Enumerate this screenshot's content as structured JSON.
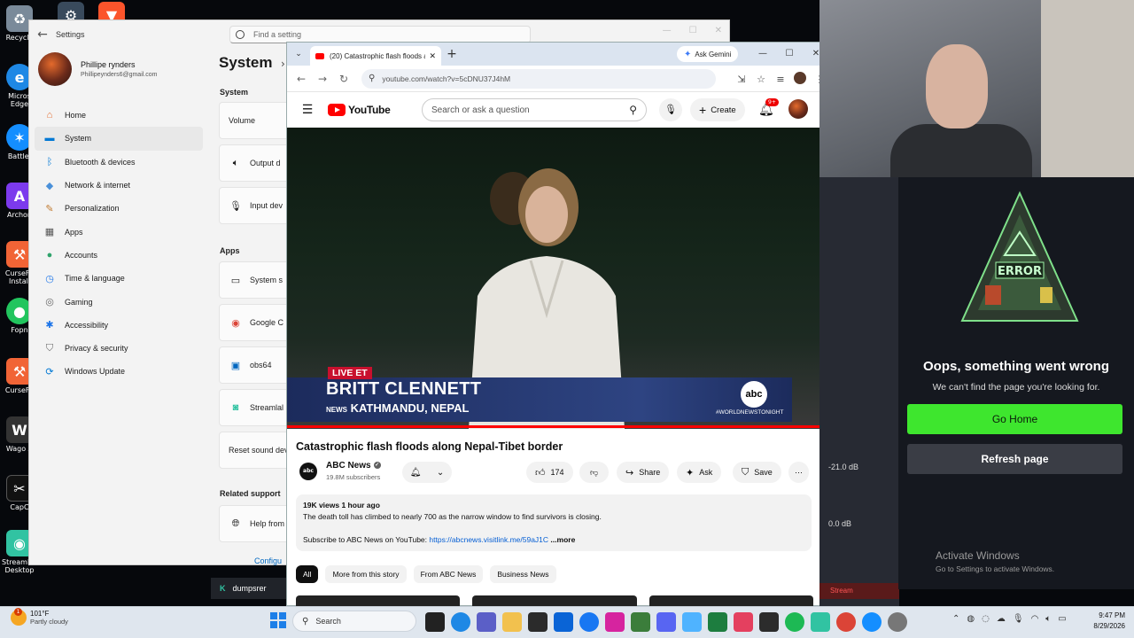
{
  "desktop": {
    "icons": [
      {
        "label": "Recycle",
        "icon": "recycle-bin-icon",
        "color": "#7a8a9a"
      },
      {
        "label": "",
        "icon": "steam-icon",
        "color": "#394a5c"
      },
      {
        "label": "",
        "icon": "brave-icon",
        "color": "#fb542b"
      },
      {
        "label": "Micros Edge",
        "icon": "edge-icon",
        "color": "#1e88e5"
      },
      {
        "label": "Battle.",
        "icon": "battlenet-icon",
        "color": "#148eff"
      },
      {
        "label": "Archon",
        "icon": "archon-icon",
        "color": "#7c3aed"
      },
      {
        "label": "CurseFo Install",
        "icon": "curseforge-icon",
        "color": "#f16436"
      },
      {
        "label": "Fopn",
        "icon": "fopn-icon",
        "color": "#22c55e"
      },
      {
        "label": "CurseFo",
        "icon": "curseforge-icon",
        "color": "#f16436"
      },
      {
        "label": "Wago A",
        "icon": "wago-icon",
        "color": "#333"
      },
      {
        "label": "CapC",
        "icon": "capcut-icon",
        "color": "#111"
      },
      {
        "label": "Streamlabs Desktop",
        "icon": "streamlabs-icon",
        "color": "#31c3a2"
      }
    ]
  },
  "settings": {
    "window_title": "Settings",
    "search_placeholder": "Find a setting",
    "profile": {
      "name": "Phillipe rynders",
      "email": "Phillipeynders6@gmail.com"
    },
    "nav": [
      {
        "label": "Home",
        "icon": "home-icon",
        "color": "#e46a2c"
      },
      {
        "label": "System",
        "icon": "system-icon",
        "color": "#0078d4",
        "active": true
      },
      {
        "label": "Bluetooth & devices",
        "icon": "bluetooth-icon",
        "color": "#0078d4"
      },
      {
        "label": "Network & internet",
        "icon": "network-icon",
        "color": "#4a90d9"
      },
      {
        "label": "Personalization",
        "icon": "personalization-icon",
        "color": "#c17a2f"
      },
      {
        "label": "Apps",
        "icon": "apps-icon",
        "color": "#555"
      },
      {
        "label": "Accounts",
        "icon": "accounts-icon",
        "color": "#2fa36b"
      },
      {
        "label": "Time & language",
        "icon": "time-language-icon",
        "color": "#1a73e8"
      },
      {
        "label": "Gaming",
        "icon": "gaming-icon",
        "color": "#666"
      },
      {
        "label": "Accessibility",
        "icon": "accessibility-icon",
        "color": "#1a73e8"
      },
      {
        "label": "Privacy & security",
        "icon": "shield-icon",
        "color": "#666"
      },
      {
        "label": "Windows Update",
        "icon": "windows-update-icon",
        "color": "#0078d4"
      }
    ],
    "heading": "System",
    "section_system": "System",
    "section_apps": "Apps",
    "section_related": "Related support",
    "cards": [
      {
        "label": "Volume",
        "icon": ""
      },
      {
        "label": "Output d",
        "icon": "speaker-icon"
      },
      {
        "label": "Input dev",
        "icon": "mic-icon"
      },
      {
        "label": "System s",
        "icon": "monitor-icon"
      },
      {
        "label": "Google C",
        "icon": "chrome-icon"
      },
      {
        "label": "obs64",
        "icon": "obs-icon"
      },
      {
        "label": "Streamlal",
        "icon": "streamlabs-icon"
      },
      {
        "label": "Reset sound dev",
        "icon": ""
      },
      {
        "label": "Help from",
        "icon": "globe-icon"
      }
    ],
    "configure_link": "Configu"
  },
  "dumps": {
    "label": "dumpsrer"
  },
  "browser": {
    "tab_title": "(20) Catastrophic flash floods a",
    "new_tab": "+",
    "gemini": "Ask Gemini",
    "url": "youtube.com/watch?v=5cDNU37J4hM"
  },
  "youtube": {
    "search_placeholder": "Search or ask a question",
    "create_label": "Create",
    "notif_badge": "9+",
    "logo_text": "YouTube",
    "video": {
      "live_tag": "LIVE ET",
      "anchor": "BRITT CLENNETT",
      "network": "NEWS",
      "location": "KATHMANDU, NEPAL",
      "logo": "abc",
      "hashtag": "#WORLDNEWSTONIGHT",
      "progress": 1.0
    },
    "title": "Catastrophic flash floods along Nepal-Tibet border",
    "channel": {
      "name": "ABC News",
      "subs": "19.8M subscribers",
      "logo": "abc NEWS"
    },
    "likes": "174",
    "share": "Share",
    "ask": "Ask",
    "save": "Save",
    "description": {
      "meta": "19K views  1 hour ago",
      "line1": "The death toll has climbed to nearly 700 as the narrow window to find survivors is closing.",
      "subscribe": "Subscribe to ABC News on YouTube: ",
      "link": "https://abcnews.visitlink.me/59aJ1C",
      "more": "...more"
    },
    "chips": [
      "All",
      "More from this story",
      "From ABC News",
      "Business News"
    ]
  },
  "error_page": {
    "title": "Oops, something went wrong",
    "subtitle": "We can't find the page you're looking for.",
    "go_home": "Go Home",
    "refresh": "Refresh page",
    "sign_text": "ERROR"
  },
  "obs": {
    "db1": "-21.0 dB",
    "db2": "0.0 dB",
    "stream": "Stream"
  },
  "watermark": {
    "line1": "Activate Windows",
    "line2": "Go to Settings to activate Windows."
  },
  "taskbar": {
    "temp": "101°F",
    "condition": "Partly cloudy",
    "weather_badge": "1",
    "search": "Search",
    "time": "9:47 PM",
    "date": "8/29/2026",
    "accent": "#1d7fe8"
  }
}
